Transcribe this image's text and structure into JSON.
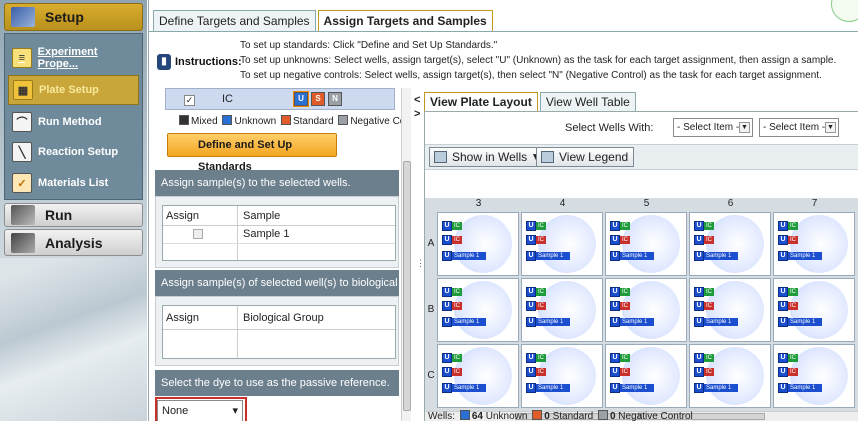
{
  "nav": {
    "setup": "Setup",
    "run": "Run",
    "analysis": "Analysis",
    "items": [
      {
        "label": "Experiment Prope..."
      },
      {
        "label": "Plate Setup"
      },
      {
        "label": "Run Method"
      },
      {
        "label": "Reaction Setup"
      },
      {
        "label": "Materials List"
      }
    ]
  },
  "tabs": [
    "Define Targets and Samples",
    "Assign Targets and Samples"
  ],
  "instructions": {
    "label": "Instructions:",
    "lines": [
      "To set up standards: Click \"Define and Set Up Standards.\"",
      "To set up unknowns: Select wells, assign target(s), select \"U\" (Unknown) as the task for each target assignment, then assign a sample.",
      "To set up negative controls: Select wells, assign target(s), then select \"N\" (Negative Control) as the task for each target assignment."
    ]
  },
  "target": {
    "checked": "✓",
    "name": "IC",
    "task_u": "U",
    "task_s": "S",
    "task_n": "N"
  },
  "task_legend": {
    "mixed": "Mixed",
    "unknown": "Unknown",
    "standard": "Standard",
    "negative": "Negative Cor"
  },
  "define_button": "Define and Set Up Standards",
  "assign_samples": {
    "title": "Assign sample(s) to the selected wells.",
    "col_assign": "Assign",
    "col_sample": "Sample",
    "rows": [
      {
        "sample": "Sample 1"
      }
    ]
  },
  "assign_bio": {
    "title": "Assign sample(s) of selected well(s) to biological g",
    "col_assign": "Assign",
    "col_group": "Biological Group"
  },
  "passive_ref": {
    "title": "Select the dye to use as the passive reference.",
    "value": "None"
  },
  "right_tabs": [
    "View Plate Layout",
    "View Well Table"
  ],
  "select_wells": {
    "label": "Select Wells With:",
    "option1": "- Select Item -",
    "option2": "- Select Item -"
  },
  "toolbar": {
    "show_in_wells": "Show in Wells ▼",
    "view_legend": "View Legend"
  },
  "plate": {
    "columns": [
      "3",
      "4",
      "5",
      "6",
      "7"
    ],
    "rows": [
      "A",
      "B",
      "C"
    ],
    "well_task": "U",
    "well_target": "IC",
    "well_target2": "IC",
    "well_sample": "Sample 1"
  },
  "summary": {
    "prefix": "Wells:",
    "unknown_count": "64",
    "unknown": "Unknown",
    "standard_count": "0",
    "standard": "Standard",
    "negative_count": "0",
    "negative": "Negative Control"
  },
  "colors": {
    "setup_accent": "#c9a63a",
    "unknown": "#2a6fd4",
    "standard": "#e25c2a",
    "negative": "#9aa0a6",
    "highlight": "#c9302c"
  }
}
